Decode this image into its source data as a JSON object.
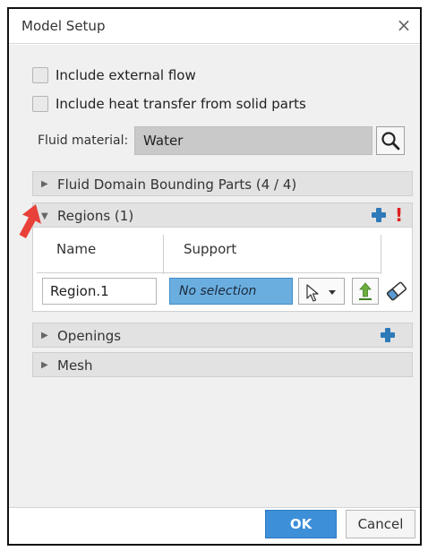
{
  "dialog": {
    "title": "Model Setup",
    "close_glyph": "×"
  },
  "options": {
    "external_flow": {
      "label": "Include external flow",
      "checked": false
    },
    "heat_transfer": {
      "label": "Include heat transfer from solid parts",
      "checked": false
    }
  },
  "fluid_material": {
    "label": "Fluid material:",
    "value": "Water",
    "icon": "magnifier-icon"
  },
  "sections": {
    "fluid_domain": {
      "label": "Fluid Domain Bounding Parts (4 / 4)",
      "expanded": false
    },
    "regions": {
      "label": "Regions (1)",
      "expanded": true,
      "warning": "!"
    },
    "openings": {
      "label": "Openings",
      "expanded": false
    },
    "mesh": {
      "label": "Mesh",
      "expanded": false
    }
  },
  "regions_table": {
    "columns": [
      "Name",
      "Support"
    ],
    "rows": [
      {
        "name": "Region.1",
        "support": "No selection"
      }
    ]
  },
  "buttons": {
    "ok": "OK",
    "cancel": "Cancel"
  },
  "colors": {
    "accent": "#3d8fd8",
    "selection": "#6aaee0",
    "warning": "#e02020",
    "add": "#2e7ab8",
    "annotation_arrow": "#e8413a"
  }
}
